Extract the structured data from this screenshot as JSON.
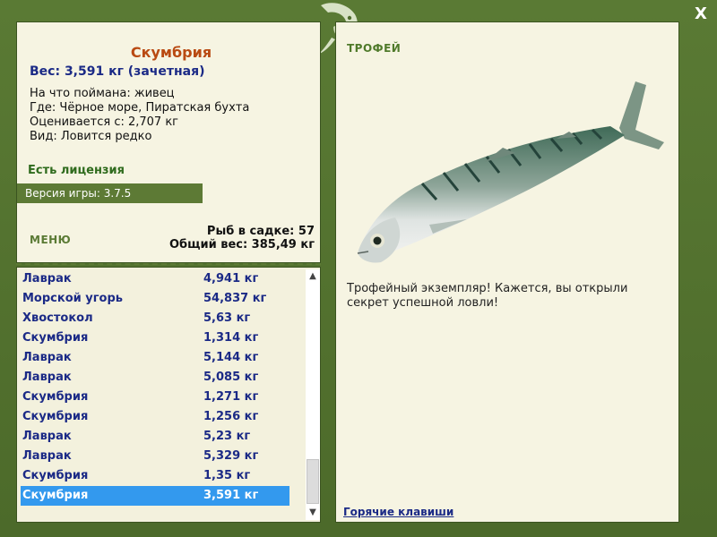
{
  "window": {
    "close_label": "X"
  },
  "details": {
    "fish_name": "Скумбрия",
    "weight_line": "Вес: 3,591 кг (зачетная)",
    "info_lines": [
      "На что поймана: живец",
      "Где: Чёрное море, Пиратская бухта",
      "Оценивается с: 2,707 кг",
      "Вид: Ловится редко"
    ],
    "license": "Есть лицензия",
    "version": "Версия игры: 3.7.5"
  },
  "menu": {
    "label": "МЕНЮ"
  },
  "cage": {
    "count_line": "Рыб в садке: 57",
    "total_line": "Общий вес: 385,49 кг"
  },
  "catch_list": [
    {
      "name": "Лаврак",
      "weight": "4,941 кг"
    },
    {
      "name": "Морской угорь",
      "weight": "54,837 кг"
    },
    {
      "name": "Хвостокол",
      "weight": "5,63 кг"
    },
    {
      "name": "Скумбрия",
      "weight": "1,314 кг"
    },
    {
      "name": "Лаврак",
      "weight": "5,144 кг"
    },
    {
      "name": "Лаврак",
      "weight": "5,085 кг"
    },
    {
      "name": "Скумбрия",
      "weight": "1,271 кг"
    },
    {
      "name": "Скумбрия",
      "weight": "1,256 кг"
    },
    {
      "name": "Лаврак",
      "weight": "5,23 кг"
    },
    {
      "name": "Лаврак",
      "weight": "5,329 кг"
    },
    {
      "name": "Скумбрия",
      "weight": "1,35 кг"
    },
    {
      "name": "Скумбрия",
      "weight": "3,591 кг",
      "selected": true
    }
  ],
  "trophy": {
    "label": "ТРОФЕЙ",
    "text": "Трофейный экземпляр! Кажется, вы открыли секрет успешной ловли!",
    "hotkeys": "Горячие клавиши"
  },
  "colors": {
    "frame": "#4f6d2e",
    "panel": "#f6f4e2",
    "title": "#b94a12",
    "text_blue": "#1b2a86",
    "selection": "#3399ee",
    "version_bar": "#5d7a35"
  },
  "icons": {
    "emblem": "fish-emblem-icon",
    "close": "close-icon",
    "scroll_up": "arrow-up-icon",
    "scroll_down": "arrow-down-icon"
  }
}
